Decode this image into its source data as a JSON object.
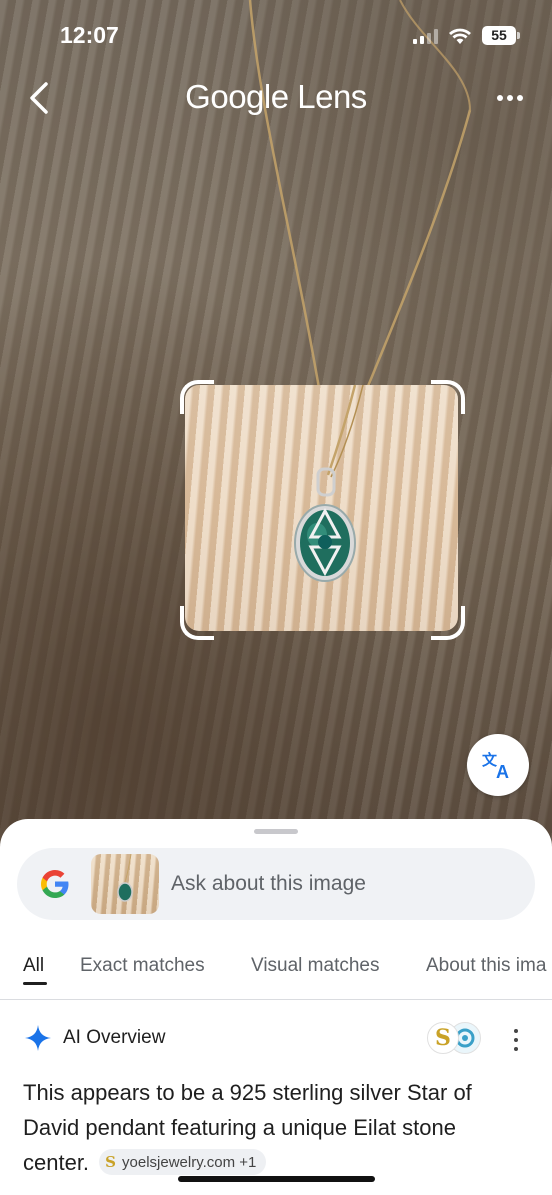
{
  "status_bar": {
    "time": "12:07",
    "battery": "55",
    "icons": [
      "cellular-signal-icon",
      "wifi-icon",
      "battery-icon"
    ]
  },
  "header": {
    "title": "Google Lens",
    "back_icon": "chevron-left-icon",
    "more_icon": "more-horizontal-icon"
  },
  "translate_icon": "translate-icon",
  "search": {
    "placeholder": "Ask about this image",
    "logo": "google-g-icon"
  },
  "tabs": [
    {
      "label": "All",
      "active": true
    },
    {
      "label": "Exact matches",
      "active": false
    },
    {
      "label": "Visual matches",
      "active": false
    },
    {
      "label": "About this ima",
      "active": false
    }
  ],
  "ai_overview": {
    "title": "AI Overview",
    "icon": "sparkle-icon",
    "source_logo_letter": "S",
    "text": "This appears to be a 925 sterling silver Star of David pendant featuring a unique Eilat stone center.",
    "source_chip": "yoelsjewelry.com +1"
  },
  "colors": {
    "sparkle": "#1a73e8",
    "sheet_bg": "#ffffff",
    "search_bg": "#f0f2f5",
    "gold": "#c9a227",
    "gem": "#1f6e5e"
  }
}
